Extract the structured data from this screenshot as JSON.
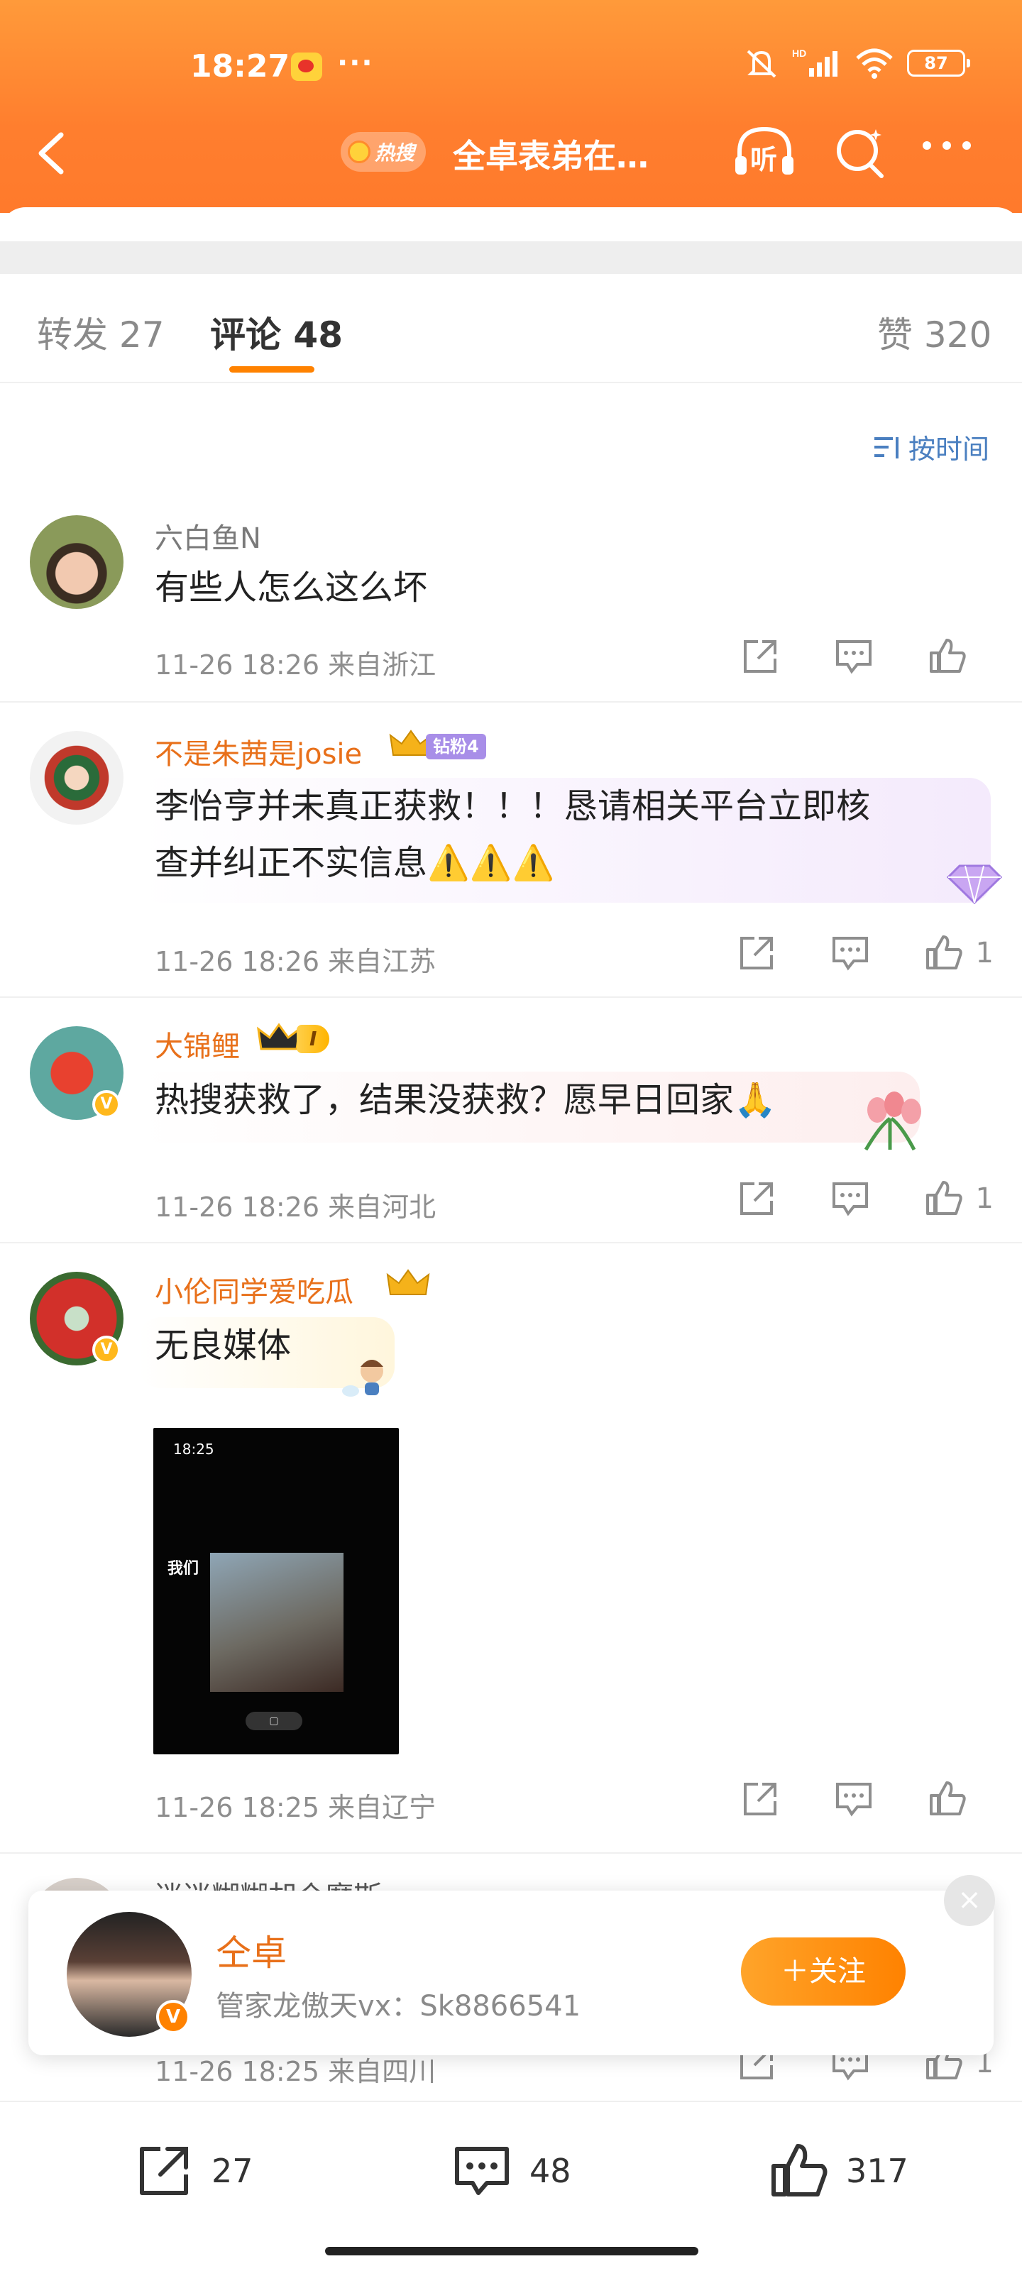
{
  "status_bar": {
    "time": "18:27",
    "battery": "87",
    "icons": [
      "weibo-notification-icon",
      "more-dots-icon",
      "mute-icon",
      "hd-signal-icon",
      "wifi-icon",
      "battery-icon"
    ]
  },
  "nav": {
    "hot_badge": "热搜",
    "title": "全卓表弟在…",
    "listen_label": "听"
  },
  "tabs": [
    {
      "label": "转发 27"
    },
    {
      "label": "评论 48"
    },
    {
      "label": "赞 320"
    }
  ],
  "sort_label": "按时间",
  "comments": [
    {
      "name": "六白鱼N",
      "text": "有些人怎么这么坏",
      "meta": "11-26 18:26  来自浙江",
      "likes": ""
    },
    {
      "name": "不是朱茜是josie",
      "badge": "钻粉4",
      "text_lines": [
        "李怡亨并未真正获救！！！恳请相关平台立即核",
        "查并纠正不实信息⚠️⚠️⚠️"
      ],
      "meta": "11-26 18:26  来自江苏",
      "likes": "1"
    },
    {
      "name": "大锦鲤",
      "level": "I",
      "text": "热搜获救了，结果没获救？愿早日回家🙏",
      "meta": "11-26 18:26  来自河北",
      "likes": "1"
    },
    {
      "name": "小伦同学爱吃瓜",
      "text": "无良媒体",
      "image": {
        "time": "18:25",
        "label": "我们"
      },
      "meta": "11-26 18:25  来自辽宁",
      "likes": ""
    },
    {
      "name": "迷迷糊糊胡仑糜斯",
      "meta": "11-26 18:25  来自四川",
      "likes": "1"
    }
  ],
  "follow_popup": {
    "name": "仝卓",
    "desc": "管家龙傲天vx：Sk8866541",
    "button": "＋关注",
    "close": "×"
  },
  "bottom_bar": {
    "repost_count": "27",
    "comment_count": "48",
    "like_count": "317"
  },
  "colors": {
    "header": "#ff8a30",
    "accent": "#ff8200",
    "vip_name": "#e8701a",
    "link_blue": "#4a7fc0"
  }
}
